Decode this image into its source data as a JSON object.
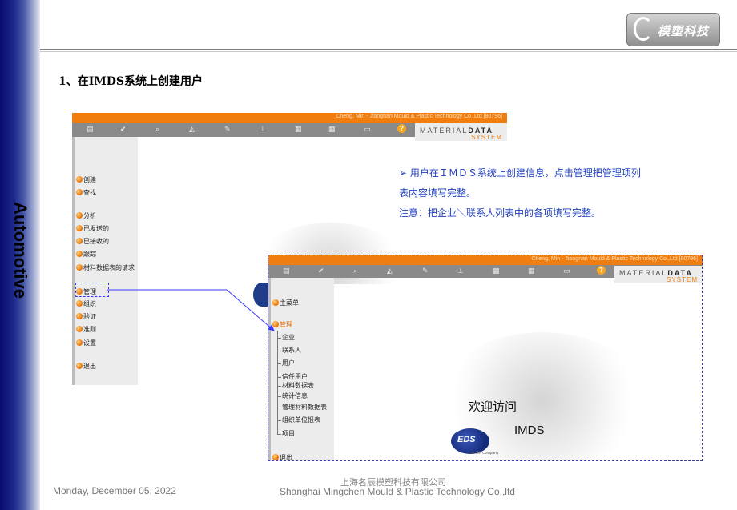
{
  "side_band": {
    "text": "Automotive"
  },
  "logo": {
    "text": "模塑科技"
  },
  "slide_title": "1、在IMDS系统上创建用户",
  "window_a": {
    "top_bar_text": "Cheng, Min   -   Jiangnan Mould & Plastic Technology Co.,Ltd [80796]",
    "brand_line1_a": "MATERIAL",
    "brand_line1_b": "DATA",
    "brand_line2": "SYSTEM",
    "menu": [
      "创建",
      "查找",
      "分析",
      "已发送的",
      "已接收的",
      "跟踪",
      "材料数据表的请求",
      "管理",
      "组织",
      "验证",
      "准则",
      "设置",
      "退出"
    ]
  },
  "window_b": {
    "top_bar_text": "Cheng, Min   -   Jiangnan Mould & Plastic Technology Co.,Ltd [80796]",
    "brand_line1_a": "MATERIAL",
    "brand_line1_b": "DATA",
    "brand_line2": "SYSTEM",
    "main_menu": "主菜单",
    "manage": "管理",
    "submenu": [
      "企业",
      "联系人",
      "用户",
      "信任用户",
      "材料数据表",
      "统计信息",
      "管理材料数据表",
      "组织单位报表",
      "项目"
    ],
    "exit": "退出",
    "welcome": "欢迎访问",
    "imds": "IMDS",
    "eds_logo": "EDS",
    "eds_sub": "an HP company"
  },
  "note": {
    "line1": "➢ 用户在ＩＭＤＳ系统上创建信息，点击管理把管理项列",
    "line2": "表内容填写完整。",
    "line3": "注意：把企业＼联系人列表中的各项填写完整。"
  },
  "footer": {
    "date": "Monday, December 05, 2022",
    "company_cn": "上海名辰模塑科技有限公司",
    "company_en": "Shanghai Mingchen Mould & Plastic  Technology Co.,ltd"
  },
  "colors": {
    "orange": "#f07d10",
    "navy": "#0a0a6e",
    "note_blue": "#1f3fbf"
  }
}
